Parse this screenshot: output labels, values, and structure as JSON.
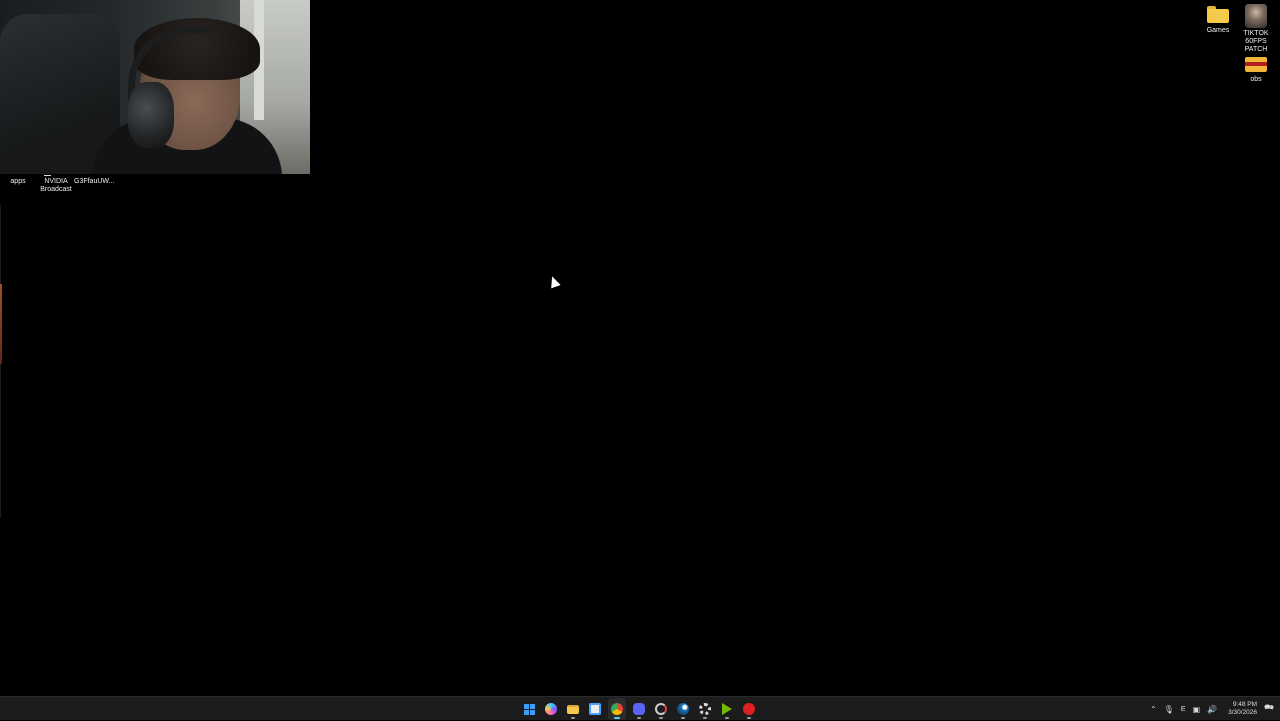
{
  "desktop": {
    "icons": {
      "apps": "apps",
      "nvidia_broadcast": "NVIDIA Broadcast",
      "g3ffau": "G3FfauUW...",
      "games": "Games",
      "tiktok_patch": "TIKTOK 60FPS PATCH",
      "obs": "obs"
    }
  },
  "taskbar": {
    "apps": [
      {
        "name": "start",
        "icon": "windows-logo-icon"
      },
      {
        "name": "copilot",
        "icon": "copilot-icon"
      },
      {
        "name": "file-explorer",
        "icon": "folder-icon"
      },
      {
        "name": "store",
        "icon": "store-icon"
      },
      {
        "name": "chrome",
        "icon": "chrome-icon"
      },
      {
        "name": "discord",
        "icon": "discord-icon"
      },
      {
        "name": "app-spiral",
        "icon": "spiral-icon"
      },
      {
        "name": "steam",
        "icon": "steam-icon"
      },
      {
        "name": "settings",
        "icon": "gear-icon"
      },
      {
        "name": "nvidia-play",
        "icon": "play-green-icon"
      },
      {
        "name": "youtube",
        "icon": "youtube-icon"
      }
    ],
    "tray": {
      "lang": "E",
      "time": "9:48 PM",
      "date": "3/30/2026"
    }
  },
  "colors": {
    "accent": "#60cdff",
    "taskbar_bg": "#1c1c1c",
    "desktop_bg": "#000000"
  }
}
